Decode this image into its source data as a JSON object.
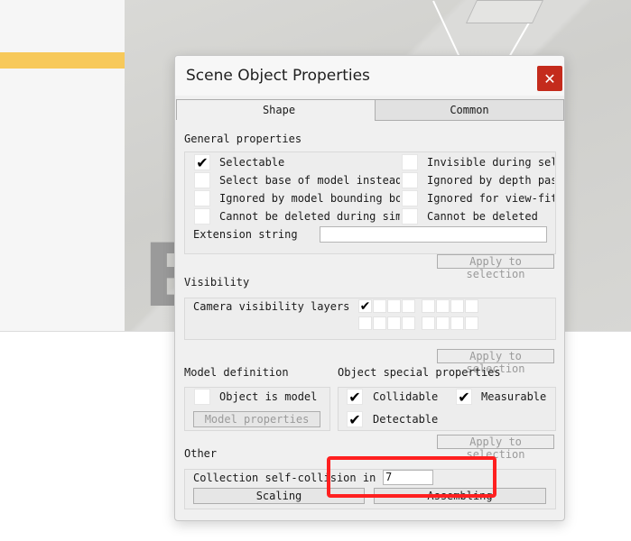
{
  "dialog": {
    "title": "Scene Object Properties",
    "close_glyph": "✕"
  },
  "tabs": [
    {
      "label": "Shape"
    },
    {
      "label": "Common"
    }
  ],
  "general": {
    "heading": "General properties",
    "options": [
      {
        "label": "Selectable",
        "checked": true
      },
      {
        "label": "Invisible during sel",
        "checked": false
      },
      {
        "label": "Select base of model instead",
        "checked": false
      },
      {
        "label": "Ignored by depth pas",
        "checked": false
      },
      {
        "label": "Ignored by model bounding  bo",
        "checked": false
      },
      {
        "label": "Ignored for view-fitt",
        "checked": false
      },
      {
        "label": "Cannot be deleted during simu",
        "checked": false
      },
      {
        "label": "Cannot be deleted",
        "checked": false
      }
    ],
    "extension_label": "Extension string",
    "extension_value": "",
    "apply_label": "Apply to selection"
  },
  "visibility": {
    "heading": "Visibility",
    "camera_label": "Camera visibility layers",
    "apply_label": "Apply to selection"
  },
  "model": {
    "heading": "Model definition",
    "object_is_model_label": "Object is model",
    "model_properties_label": "Model properties"
  },
  "special": {
    "heading": "Object special properties",
    "collidable_label": "Collidable",
    "measurable_label": "Measurable",
    "detectable_label": "Detectable",
    "apply_label": "Apply to selection"
  },
  "other": {
    "heading": "Other",
    "collection_label": "Collection self-collision ind",
    "collection_value": "7",
    "scaling_label": "Scaling",
    "assembling_label": "Assembling"
  },
  "checkmark": "✔",
  "colors": {
    "close_button": "#c42b1c",
    "highlight": "#ff2020",
    "accent_bar": "#f7c95a"
  }
}
